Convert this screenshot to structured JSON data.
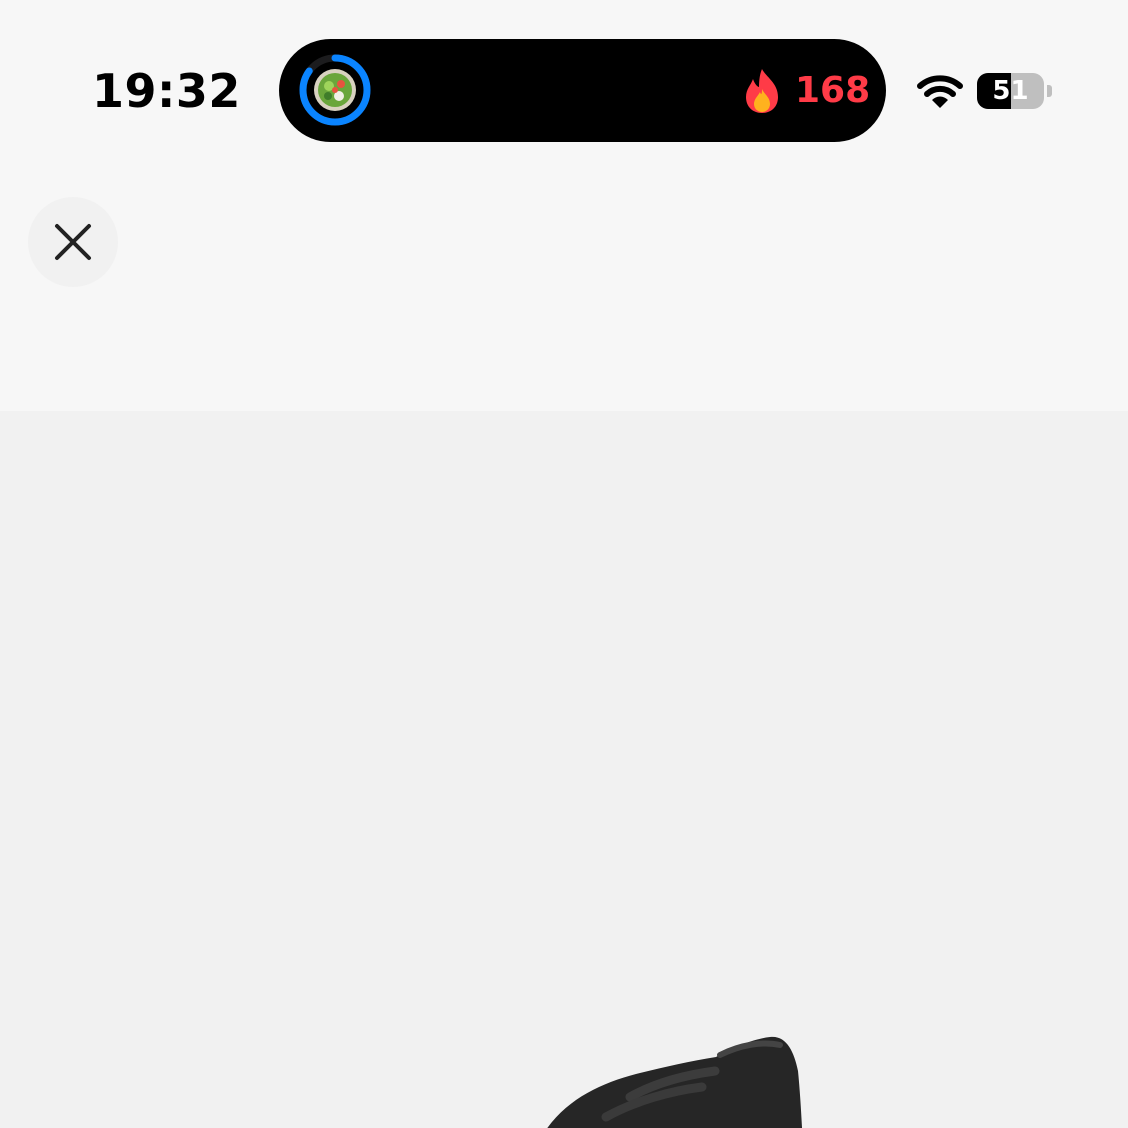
{
  "status_bar": {
    "time": "19:32",
    "battery_percent": 51,
    "battery_label": "51",
    "wifi_icon": "wifi-icon"
  },
  "dynamic_island": {
    "activity_ring_progress": 0.85,
    "ring_color": "#0a84ff",
    "streak_count": "168",
    "streak_color": "#ff3b47",
    "icons": [
      "food-bowl-icon",
      "flame-icon"
    ]
  },
  "header": {
    "close_icon": "close-icon"
  },
  "product": {
    "image": "sneaker-image",
    "background": "#f1f1f1"
  }
}
